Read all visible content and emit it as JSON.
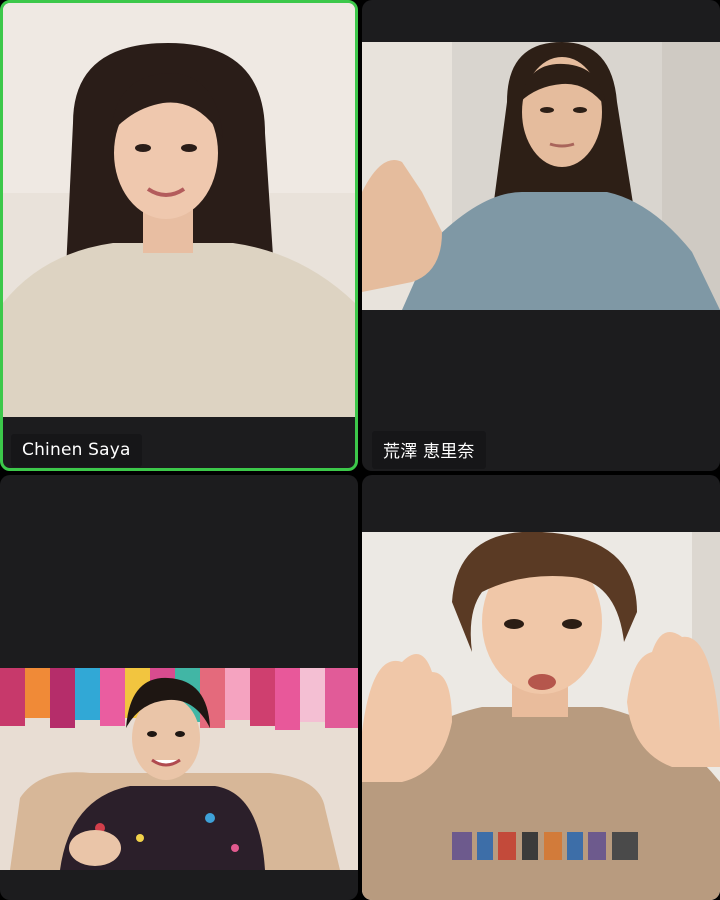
{
  "participants": [
    {
      "name": "Chinen Saya",
      "active_speaker": true,
      "active_color": "#3cc84a",
      "video": {
        "bg": "#e9e2da",
        "hair": "#2a1d18",
        "skin": "#efc8ae",
        "clothing": "#ddd3c2"
      }
    },
    {
      "name": "荒澤 恵里奈",
      "active_speaker": false,
      "video": {
        "bg": "#d9d5cf",
        "hair": "#2d1f16",
        "skin": "#e5bc9d",
        "clothing": "#7f98a5"
      }
    },
    {
      "name": "",
      "active_speaker": false,
      "video": {
        "bg": "#e8ddd3",
        "hair": "#1e1612",
        "skin": "#eac5a8",
        "clothing": "#2b1f2a"
      }
    },
    {
      "name": "",
      "active_speaker": false,
      "video": {
        "bg": "#ece9e4",
        "hair": "#5a3a24",
        "skin": "#f0c7a8",
        "clothing": "#b89b7f"
      }
    }
  ],
  "icons": {
    "tile_video": "person-video-icon"
  }
}
